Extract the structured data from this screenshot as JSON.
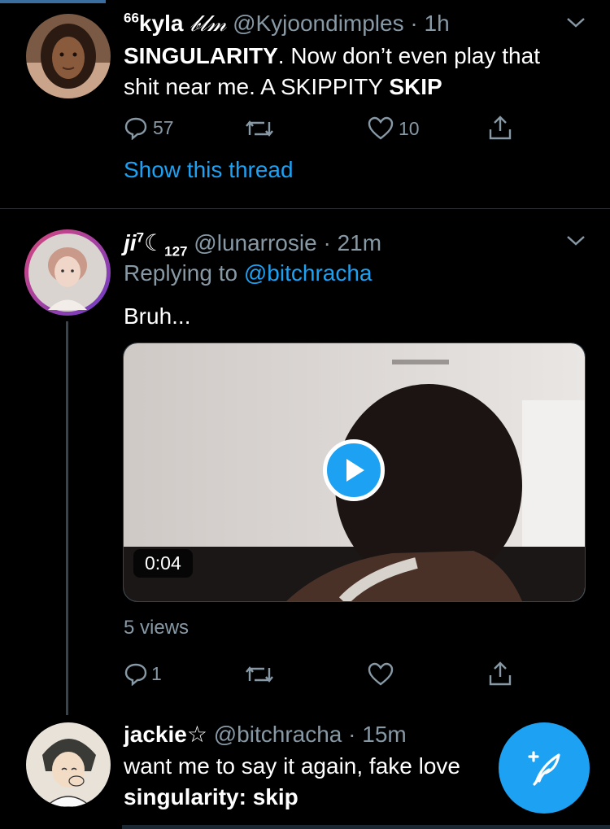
{
  "tweets": [
    {
      "name_prefix": "66",
      "name": "kyla",
      "name_suffix": "𝒷𝓁𝓂",
      "handle": "@Kyjoondimples",
      "time": "1h",
      "text_bold1": "SINGULARITY",
      "text_mid": ". Now don’t even play that",
      "text_line2_start": "shit near me. A SKIPPITY ",
      "text_bold2": "SKIP",
      "replies": "57",
      "likes": "10",
      "show_thread": "Show this thread"
    },
    {
      "name": "ji",
      "name_sup": "7",
      "name_sub": "127",
      "handle": "@lunarrosie",
      "time": "21m",
      "replying_prefix": "Replying to ",
      "replying_handle": "@bitchracha",
      "text": "Bruh...",
      "video_duration": "0:04",
      "views": "5 views",
      "replies": "1"
    },
    {
      "name": "jackie",
      "name_suffix": "☆",
      "handle": "@bitchracha",
      "time": "15m",
      "text_line1": "want me to say it again, fake love",
      "text_line2": "singularity: skip"
    }
  ],
  "sep": "·",
  "colors": {
    "accent": "#1da1f2",
    "meta": "#8899a6",
    "divider": "#2f3336"
  }
}
